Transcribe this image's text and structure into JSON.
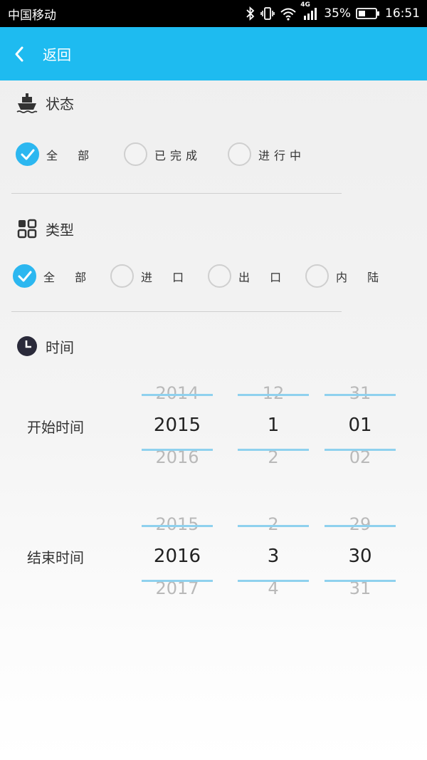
{
  "status_bar": {
    "carrier": "中国移动",
    "network": "4G",
    "battery": "35%",
    "time": "16:51",
    "icons": [
      "bluetooth-icon",
      "vibrate-icon",
      "wifi-icon",
      "signal-icon",
      "battery-icon"
    ]
  },
  "header": {
    "back_label": "返回",
    "background": "#1ebbf0"
  },
  "status_section": {
    "title": "状态",
    "icon": "ship-icon",
    "options": [
      {
        "label": "全  部",
        "checked": true
      },
      {
        "label": "已完成",
        "checked": false
      },
      {
        "label": "进行中",
        "checked": false
      }
    ]
  },
  "type_section": {
    "title": "类型",
    "icon": "grid-icon",
    "options": [
      {
        "label": "全  部",
        "checked": true
      },
      {
        "label": "进  口",
        "checked": false
      },
      {
        "label": "出  口",
        "checked": false
      },
      {
        "label": "内  陆",
        "checked": false
      }
    ]
  },
  "time_section": {
    "title": "时间",
    "icon": "clock-icon",
    "start": {
      "label": "开始时间",
      "year": {
        "prev": "2014",
        "current": "2015",
        "next": "2016"
      },
      "month": {
        "prev": "12",
        "current": "1",
        "next": "2"
      },
      "day": {
        "prev": "31",
        "current": "01",
        "next": "02"
      }
    },
    "end": {
      "label": "结束时间",
      "year": {
        "prev": "2015",
        "current": "2016",
        "next": "2017"
      },
      "month": {
        "prev": "2",
        "current": "3",
        "next": "4"
      },
      "day": {
        "prev": "29",
        "current": "30",
        "next": "31"
      }
    }
  },
  "accent_color": "#2cb7f0"
}
